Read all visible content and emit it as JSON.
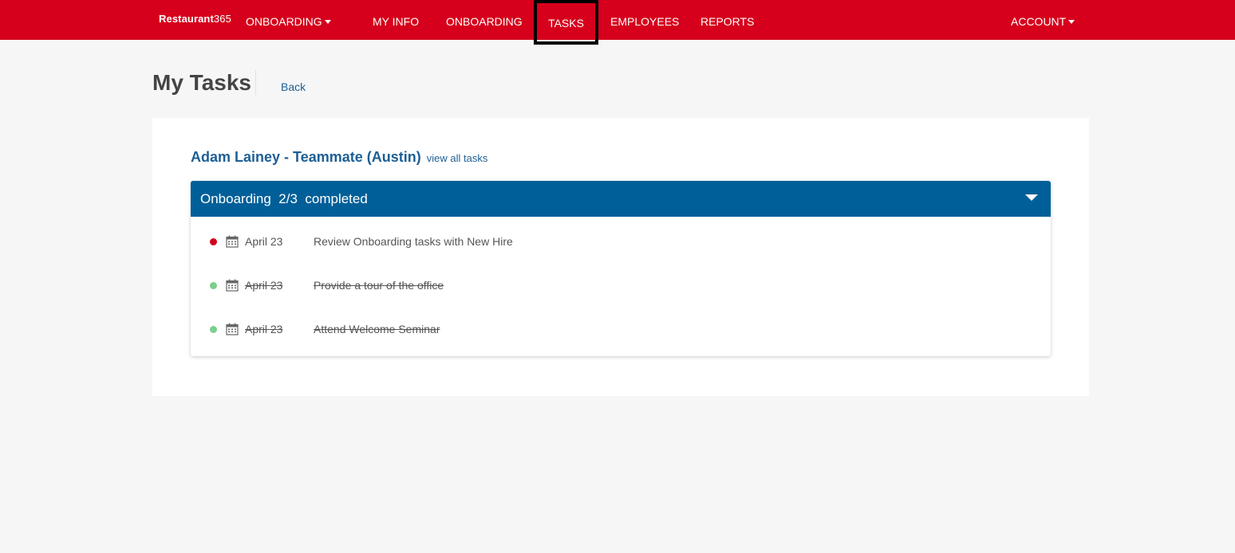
{
  "nav": {
    "brand_text": "Restaurant",
    "brand_num": "365",
    "app_menu": "ONBOARDING",
    "items": [
      "MY INFO",
      "ONBOARDING",
      "TASKS",
      "EMPLOYEES",
      "REPORTS"
    ],
    "account": "ACCOUNT",
    "active_item": "TASKS"
  },
  "page": {
    "title": "My Tasks",
    "back": "Back"
  },
  "card": {
    "person": "Adam Lainey - Teammate (Austin)",
    "view_all": "view all tasks",
    "section_title": "Onboarding  2/3  completed",
    "tasks": [
      {
        "date": "April 23",
        "title": "Review Onboarding tasks with New Hire",
        "completed": false,
        "status_color": "#d0021b"
      },
      {
        "date": "April 23",
        "title": "Provide a tour of the office",
        "completed": true,
        "status_color": "#7bcf8c"
      },
      {
        "date": "April 23",
        "title": "Attend Welcome Seminar",
        "completed": true,
        "status_color": "#7bcf8c"
      }
    ]
  },
  "colors": {
    "nav_bg": "#d6001c",
    "panel_header": "#005f98",
    "link": "#1d5f95"
  }
}
